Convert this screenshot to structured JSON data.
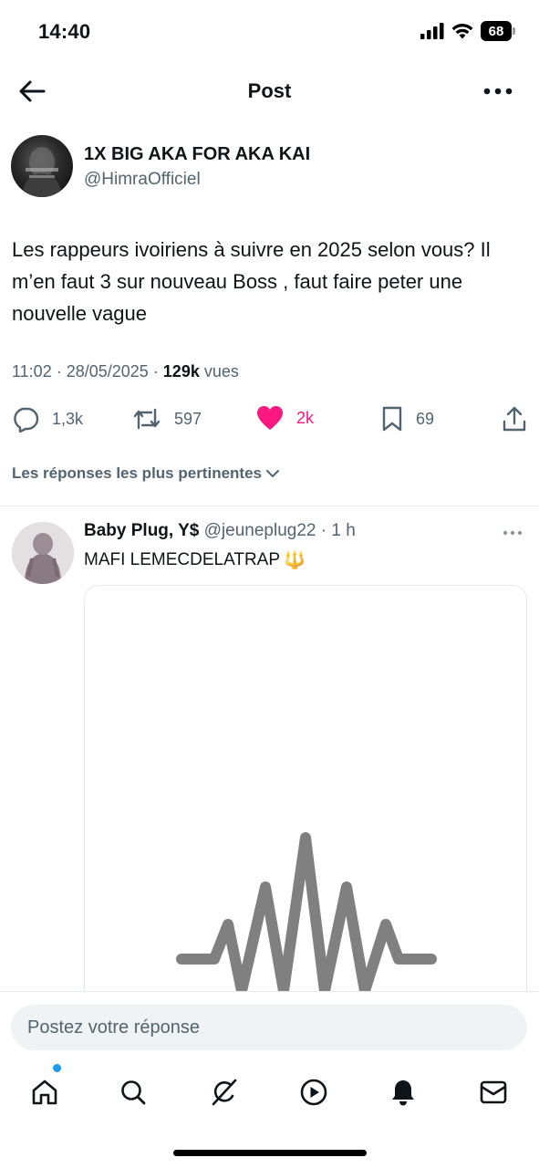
{
  "status_bar": {
    "time": "14:40",
    "battery": "68",
    "icons": [
      "signal-icon",
      "wifi-icon",
      "battery-icon"
    ]
  },
  "nav": {
    "title": "Post",
    "back_icon": "back-arrow-icon",
    "more_icon": "more-horizontal-icon"
  },
  "post": {
    "author_name": "1X BIG AKA FOR AKA KAI",
    "author_handle": "@HimraOfficiel",
    "text": "Les rappeurs ivoiriens à suivre en 2025 selon vous? Il m’en faut 3 sur nouveau Boss , faut faire peter une nouvelle vague",
    "timestamp": "11:02 · 28/05/2025 · ",
    "views_count": "129k",
    "views_label": " vues",
    "stats": {
      "replies": "1,3k",
      "reposts": "597",
      "likes": "2k",
      "bookmarks": "69"
    },
    "liked": true
  },
  "replies_section": {
    "sort_label": "Les réponses les plus pertinentes"
  },
  "reply": {
    "name": "Baby Plug, Y$",
    "handle": "@jeuneplug22",
    "separator": " · ",
    "time": "1 h",
    "text": "MAFI LEMECDELATRAP",
    "emoji": "🔱"
  },
  "composer": {
    "placeholder": "Postez votre réponse"
  },
  "tabbar": {
    "items": [
      "home-icon",
      "search-icon",
      "grok-icon",
      "video-icon",
      "notifications-icon",
      "messages-icon"
    ]
  },
  "colors": {
    "accent": "#1d9bf0",
    "like": "#f91880",
    "secondary_text": "#536471"
  }
}
